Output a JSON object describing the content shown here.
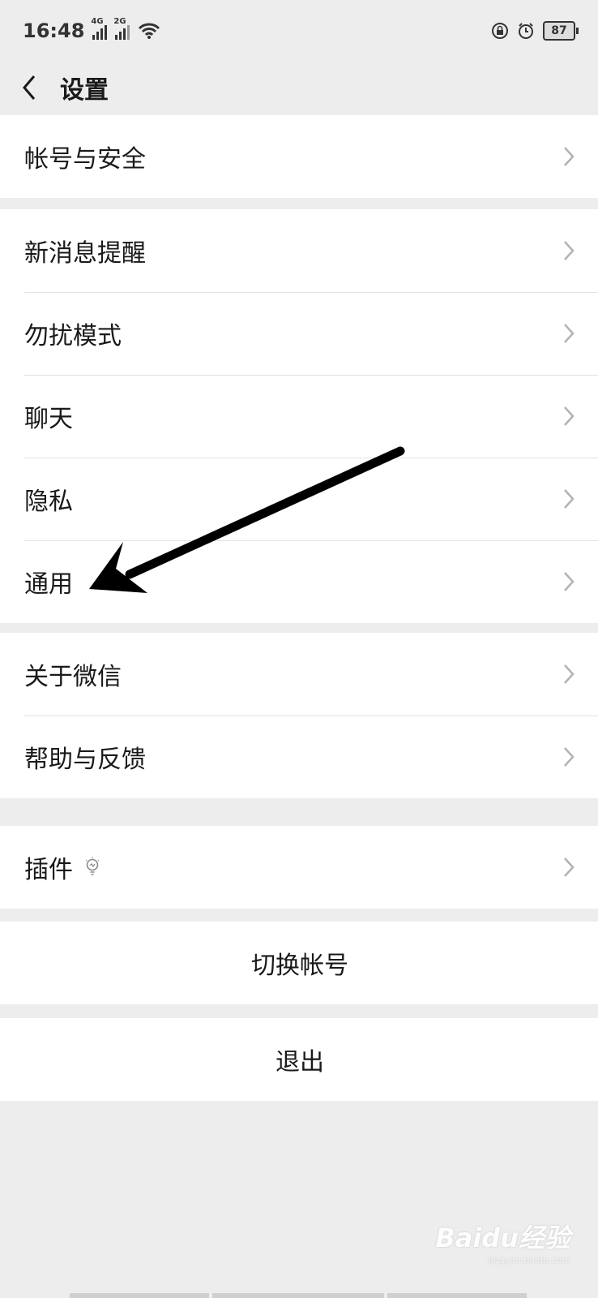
{
  "status_bar": {
    "time": "16:48",
    "signal1_net": "4G",
    "signal2_net": "2G",
    "battery": "87",
    "icons": [
      "rotation-lock-icon",
      "alarm-icon",
      "wifi-icon"
    ]
  },
  "header": {
    "title": "设置"
  },
  "groups": {
    "account": "帐号与安全",
    "notifications": "新消息提醒",
    "dnd": "勿扰模式",
    "chat": "聊天",
    "privacy": "隐私",
    "general": "通用",
    "about": "关于微信",
    "help": "帮助与反馈",
    "plugins": "插件"
  },
  "actions": {
    "switch_account": "切换帐号",
    "logout": "退出"
  },
  "watermark": {
    "text": "Baidu经验",
    "url": "jingyan.baidu.com"
  },
  "colors": {
    "background": "#ededed",
    "row": "#ffffff",
    "divider": "#e3e3e3",
    "chevron": "#b2b2b2"
  }
}
